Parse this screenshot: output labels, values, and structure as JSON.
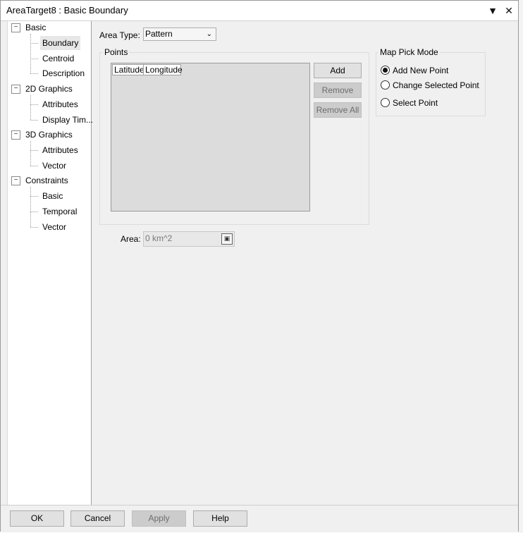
{
  "window": {
    "title": "AreaTarget8 : Basic Boundary"
  },
  "titlebar_icons": {
    "dropdown": "chevron-down-icon",
    "close": "close-icon"
  },
  "tree": {
    "groups": [
      {
        "label": "Basic",
        "children": [
          "Boundary",
          "Centroid",
          "Description"
        ]
      },
      {
        "label": "2D Graphics",
        "children": [
          "Attributes",
          "Display Tim..."
        ]
      },
      {
        "label": "3D Graphics",
        "children": [
          "Attributes",
          "Vector"
        ]
      },
      {
        "label": "Constraints",
        "children": [
          "Basic",
          "Temporal",
          "Vector"
        ]
      }
    ],
    "selected": "Boundary",
    "toggle_glyph": "−"
  },
  "area_type": {
    "label": "Area Type:",
    "value": "Pattern"
  },
  "points": {
    "label": "Points",
    "columns": [
      "Latitude",
      "Longitude"
    ],
    "rows": [],
    "buttons": {
      "add": "Add",
      "remove": "Remove",
      "remove_all": "Remove All"
    }
  },
  "map_pick": {
    "label": "Map Pick Mode",
    "options": [
      "Add New Point",
      "Change Selected Point",
      "Select Point"
    ],
    "selected": "Add New Point"
  },
  "area": {
    "label": "Area:",
    "value": "0 km^2"
  },
  "footer": {
    "ok": "OK",
    "cancel": "Cancel",
    "apply": "Apply",
    "help": "Help"
  }
}
